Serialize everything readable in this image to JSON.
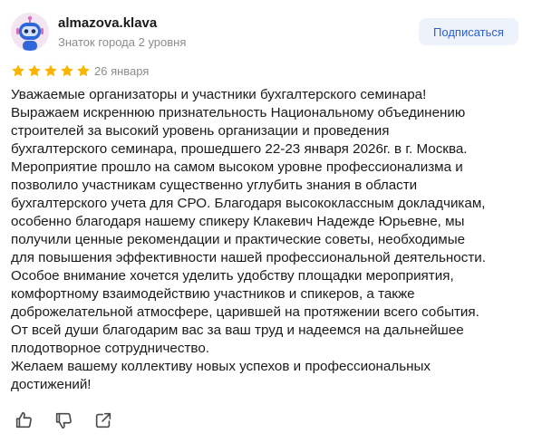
{
  "author": {
    "name": "almazova.klava",
    "level": "Знаток города 2 уровня",
    "avatar_icon": "robot-avatar"
  },
  "subscribe_label": "Подписаться",
  "rating": {
    "stars": 5,
    "max": 5,
    "color": "#f7b500"
  },
  "date": "26 января",
  "review_lines": [
    "Уважаемые организаторы и участники бухгалтерского семинара!",
    "Выражаем искреннюю признательность Национальному объединению",
    "строителей за высокий уровень организации и проведения",
    "бухгалтерского семинара, прошедшего 22-23 января 2026г. в г. Москва.",
    "Мероприятие прошло на самом высоком уровне профессионализма и",
    "позволило участникам существенно углубить знания в области",
    "бухгалтерского учета для СРО. Благодаря высококлассным докладчикам,",
    "особенно благодаря нашему спикеру Клакевич Надежде Юрьевне, мы",
    "получили ценные рекомендации и практические советы, необходимые",
    "для повышения эффективности нашей профессиональной деятельности.",
    "Особое внимание хочется уделить удобству площадки мероприятия,",
    "комфортному взаимодействию участников и спикеров, а также",
    "доброжелательной атмосфере, царившей на протяжении всего события.",
    "От всей души благодарим вас за ваш труд и надеемся на дальнейшее",
    "плодотворное сотрудничество.",
    "Желаем вашему коллективу новых успехов и профессиональных",
    "достижений!"
  ],
  "actions": [
    "thumbs-up-icon",
    "thumbs-down-icon",
    "share-icon"
  ]
}
